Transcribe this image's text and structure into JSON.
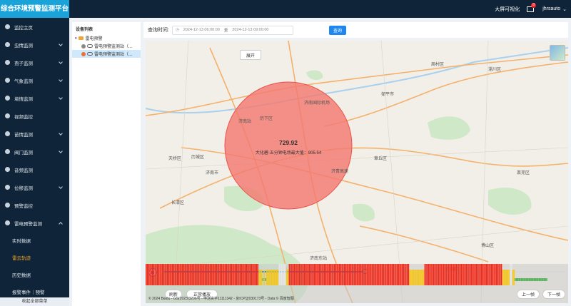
{
  "header": {
    "title": "综合环境预警监测平台",
    "big_screen": "大屏可视化",
    "notification_count": "8",
    "username": "jhrsauto"
  },
  "sidebar": {
    "items": [
      {
        "label": "监控主页",
        "expandable": false
      },
      {
        "label": "虫情监测",
        "expandable": true
      },
      {
        "label": "孢子监测",
        "expandable": true
      },
      {
        "label": "气象监测",
        "expandable": true
      },
      {
        "label": "墒情监测",
        "expandable": true
      },
      {
        "label": "视频监控",
        "expandable": false
      },
      {
        "label": "苗情监测",
        "expandable": true
      },
      {
        "label": "阀门监测",
        "expandable": true
      },
      {
        "label": "音频监测",
        "expandable": false
      },
      {
        "label": "位移监测",
        "expandable": true
      },
      {
        "label": "预警监控",
        "expandable": false
      },
      {
        "label": "雷电预警监测",
        "expandable": true,
        "expanded": true
      }
    ],
    "subitems": [
      {
        "label": "实时数据",
        "active": false
      },
      {
        "label": "雷云轨迹",
        "active": true
      },
      {
        "label": "历史数据",
        "active": false
      },
      {
        "label": "报警事件｜预警",
        "active": false
      }
    ],
    "footer": "收起全部菜单"
  },
  "tree": {
    "title": "设备列表",
    "root": "雷电预警",
    "children": [
      {
        "label": "雷电预警监测站（...",
        "dot": "#888888",
        "selected": false
      },
      {
        "label": "雷电预警监测站（...",
        "dot": "#e8742c",
        "selected": true
      }
    ]
  },
  "query": {
    "label": "查询时间:",
    "start": "2024-12-13 06:00:00",
    "separator": "至",
    "end": "2024-12-13 09:00:00",
    "button": "查询"
  },
  "map": {
    "collapse_button": "展开",
    "strike_value": "729.92",
    "strike_desc": "大化碧-五分钟电场最大值：905.54",
    "place_labels": [
      {
        "name": "济南市"
      },
      {
        "name": "历城区"
      },
      {
        "name": "历下区"
      },
      {
        "name": "天桥区"
      },
      {
        "name": "济南国际机场"
      },
      {
        "name": "章丘区"
      },
      {
        "name": "邹平市"
      },
      {
        "name": "周村区"
      },
      {
        "name": "淄川区"
      },
      {
        "name": "博山区"
      },
      {
        "name": "莱芜区"
      },
      {
        "name": "长清区"
      },
      {
        "name": "泰山区"
      },
      {
        "name": "济南站"
      },
      {
        "name": "济南东站"
      },
      {
        "name": "济青高速"
      }
    ],
    "attribution": "© 2024 Baidu - GS(2023)3206号 - 甲测资字11111342 - 京ICP证030173号 - Data © 百度智图",
    "colors": {
      "strike_fill": "#f37a72",
      "strike_stroke": "#e8534a",
      "bar_red": "#f02a1a",
      "bar_yellow": "#f5c518",
      "bar_green": "#4caf50",
      "bar_white": "#e6e6e6"
    }
  },
  "timeline": {
    "progress": 0.5,
    "prev_label": "上一帧",
    "next_label": "下一帧",
    "refresh_label": "刷新",
    "replay_label": "正常播放",
    "levels": [
      "r",
      "r",
      "r",
      "r",
      "r",
      "r",
      "r",
      "r",
      "r",
      "r",
      "r",
      "r",
      "r",
      "r",
      "r",
      "r",
      "r",
      "r",
      "r",
      "r",
      "r",
      "r",
      "r",
      "r",
      "r",
      "r",
      "r",
      "r",
      "r",
      "r",
      "r",
      "r",
      "r",
      "r",
      "r",
      "r",
      "r",
      "r",
      "r",
      "r",
      "r",
      "r",
      "r",
      "r",
      "r",
      "r",
      "r",
      "r",
      "r",
      "r",
      "r",
      "r",
      "r",
      "r",
      "r",
      "r",
      "r",
      "r",
      "r",
      "r",
      "r",
      "r",
      "r",
      "r",
      "r",
      "r",
      "r",
      "r",
      "r",
      "r",
      "r",
      "r",
      "r",
      "r",
      "r",
      "r",
      "r",
      "r",
      "r",
      "r",
      "r",
      "r",
      "r",
      "r",
      "r",
      "r",
      "r",
      "r",
      "r",
      "r",
      "y",
      "y",
      "y",
      "g",
      "y",
      "g",
      "y",
      "y",
      "y",
      "y",
      "y",
      "y",
      "y",
      "y",
      "y",
      "y",
      "w",
      "w",
      "w",
      "w",
      "w",
      "w",
      "y",
      "y",
      "r",
      "r",
      "r",
      "r",
      "r",
      "r",
      "r",
      "r",
      "r",
      "r",
      "r",
      "r",
      "r",
      "r",
      "r",
      "r",
      "r",
      "r",
      "r",
      "r",
      "r",
      "r",
      "r",
      "r",
      "r",
      "r",
      "r",
      "r",
      "r",
      "r",
      "r",
      "r",
      "r",
      "r",
      "r",
      "r",
      "r",
      "r",
      "r",
      "r",
      "r",
      "r",
      "r",
      "r",
      "r",
      "r",
      "r",
      "r",
      "r",
      "r",
      "r",
      "r",
      "r",
      "r",
      "r",
      "r",
      "r",
      "r",
      "r",
      "r",
      "r",
      "r",
      "r",
      "r",
      "r",
      "r",
      "r",
      "r",
      "r",
      "r",
      "r",
      "r",
      "r",
      "r",
      "r",
      "r",
      "r",
      "r",
      "r",
      "r",
      "r",
      "r",
      "r",
      "r",
      "r",
      "r",
      "r",
      "r",
      "r",
      "r",
      "r",
      "r",
      "r",
      "r",
      "r",
      "r",
      "y",
      "y",
      "y",
      "y",
      "y",
      "y",
      "y",
      "y",
      "y",
      "y",
      "y",
      "y",
      "r",
      "r",
      "r",
      "r",
      "r",
      "r",
      "r",
      "r",
      "r",
      "r",
      "r",
      "r",
      "r",
      "r",
      "r",
      "r",
      "r",
      "r",
      "r",
      "r",
      "r",
      "r",
      "r",
      "r",
      "r",
      "r",
      "r",
      "r",
      "r",
      "r",
      "r",
      "r",
      "r",
      "r",
      "r",
      "r",
      "r",
      "r",
      "r",
      "r",
      "r",
      "r",
      "r",
      "r",
      "r",
      "r",
      "r",
      "r",
      "r",
      "r",
      "r",
      "r",
      "r",
      "r",
      "r",
      "r",
      "r",
      "r",
      "r",
      "r",
      "r",
      "r",
      "y",
      "y",
      "y",
      "y",
      "y",
      "y",
      "w",
      "w",
      "y",
      "y",
      "g",
      "g",
      "g",
      "g",
      "g",
      "g",
      "g",
      "g",
      "g",
      "g",
      "g",
      "g",
      "g",
      "g",
      "g",
      "g",
      "g",
      "g",
      "g",
      "g",
      "g",
      "g",
      "g",
      "g",
      "g",
      "g"
    ]
  }
}
